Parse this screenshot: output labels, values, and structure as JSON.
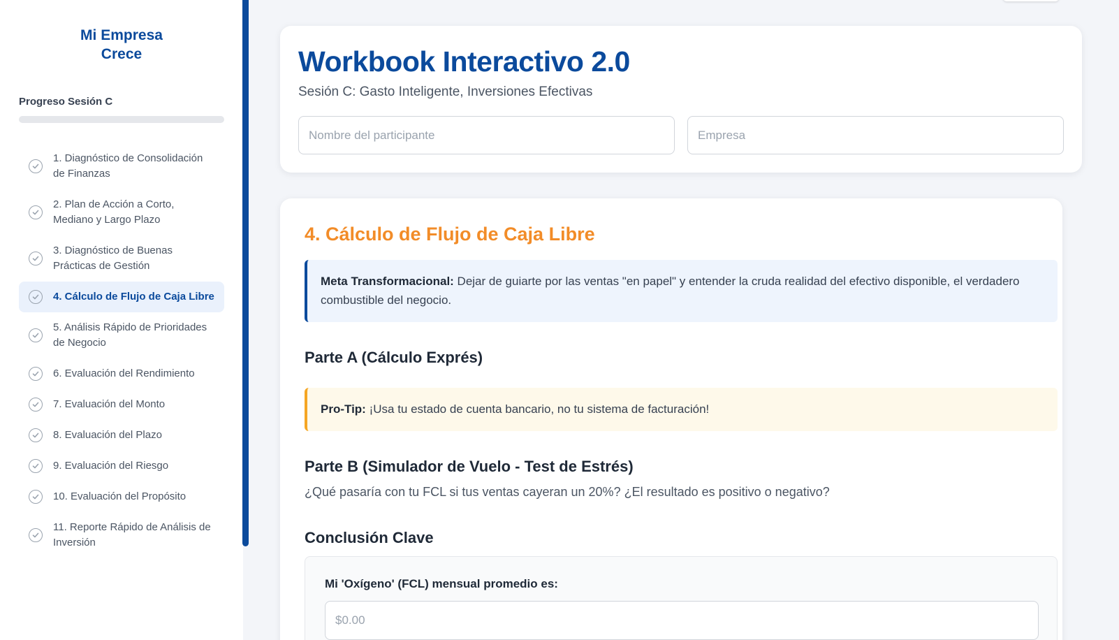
{
  "sidebar": {
    "brand_line1": "Mi Empresa",
    "brand_line2": "Crece",
    "progress_label": "Progreso Sesión C",
    "progress_value": 0,
    "items": [
      {
        "label": "1. Diagnóstico de Consolidación de Finanzas",
        "active": false
      },
      {
        "label": "2. Plan de Acción a Corto, Mediano y Largo Plazo",
        "active": false
      },
      {
        "label": "3. Diagnóstico de Buenas Prácticas de Gestión",
        "active": false
      },
      {
        "label": "4. Cálculo de Flujo de Caja Libre",
        "active": true
      },
      {
        "label": "5. Análisis Rápido de Prioridades de Negocio",
        "active": false
      },
      {
        "label": "6. Evaluación del Rendimiento",
        "active": false
      },
      {
        "label": "7. Evaluación del Monto",
        "active": false
      },
      {
        "label": "8. Evaluación del Plazo",
        "active": false
      },
      {
        "label": "9. Evaluación del Riesgo",
        "active": false
      },
      {
        "label": "10. Evaluación del Propósito",
        "active": false
      },
      {
        "label": "11. Reporte Rápido de Análisis de Inversión",
        "active": false
      }
    ],
    "item_icon": "check-circle-icon"
  },
  "header": {
    "title": "Workbook Interactivo 2.0",
    "subtitle": "Sesión C: Gasto Inteligente, Inversiones Efectivas",
    "participant_placeholder": "Nombre del participante",
    "company_placeholder": "Empresa"
  },
  "section": {
    "title": "4. Cálculo de Flujo de Caja Libre",
    "meta_label": "Meta Transformacional:",
    "meta_text": " Dejar de guiarte por las ventas \"en papel\" y entender la cruda realidad del efectivo disponible, el verdadero combustible del negocio.",
    "part_a_title": "Parte A (Cálculo Exprés)",
    "tip_label": "Pro-Tip:",
    "tip_text": " ¡Usa tu estado de cuenta bancario, no tu sistema de facturación!",
    "part_b_title": "Parte B (Simulador de Vuelo - Test de Estrés)",
    "part_b_question": "¿Qué pasaría con tu FCL si tus ventas cayeran un 20%? ¿El resultado es positivo o negativo?",
    "conclusion_title": "Conclusión Clave",
    "conclusion_label": "Mi 'Oxígeno' (FCL) mensual promedio es:",
    "conclusion_placeholder": "$0.00"
  },
  "colors": {
    "brand": "#0b4a9c",
    "accent": "#f28c28",
    "meta_bg": "#eef4fd",
    "tip_bg": "#fef9ea",
    "tip_border": "#f5a623"
  }
}
